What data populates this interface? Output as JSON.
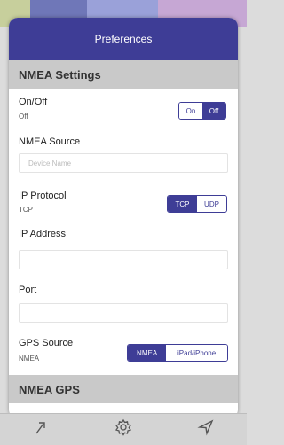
{
  "header": {
    "title": "Preferences"
  },
  "sections": {
    "nmea_settings": "NMEA Settings",
    "nmea_gps": "NMEA GPS"
  },
  "on_off": {
    "label": "On/Off",
    "value": "Off",
    "options": [
      "On",
      "Off"
    ],
    "selected": "Off"
  },
  "nmea_source": {
    "label": "NMEA Source",
    "placeholder": "Device Name",
    "value": ""
  },
  "ip_protocol": {
    "label": "IP Protocol",
    "value": "TCP",
    "options": [
      "TCP",
      "UDP"
    ],
    "selected": "TCP"
  },
  "ip_address": {
    "label": "IP Address",
    "value": ""
  },
  "port": {
    "label": "Port",
    "value": ""
  },
  "gps_source": {
    "label": "GPS Source",
    "value": "NMEA",
    "options": [
      "NMEA",
      "iPad/iPhone"
    ],
    "selected": "NMEA"
  },
  "toolbar": {
    "icons": [
      "share-arrow-icon",
      "settings-gear-icon",
      "navigation-arrow-icon"
    ]
  },
  "colors": {
    "accent": "#3e3d96",
    "section_bg": "#c9c9c9",
    "panel_bg": "#ffffff"
  }
}
